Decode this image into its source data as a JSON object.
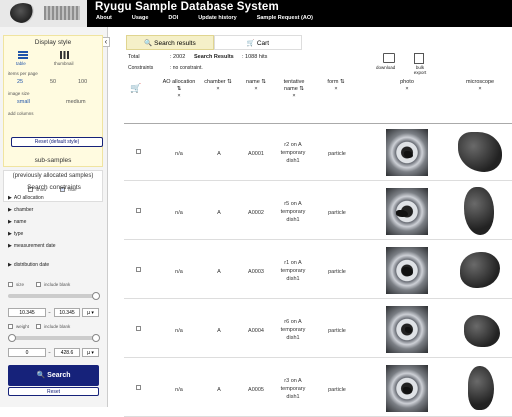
{
  "header": {
    "title": "Ryugu Sample Database System",
    "nav": [
      "About",
      "Usage",
      "DOI",
      "Update history",
      "Sample Request (AO)"
    ]
  },
  "sidebar": {
    "display_style_title": "Display style",
    "views": [
      "table",
      "thumbnail"
    ],
    "items_per_page_label": "items per page",
    "items_per_page": [
      "25",
      "50",
      "100"
    ],
    "image_size_label": "image size",
    "image_size": [
      "small",
      "medium"
    ],
    "add_columns": "add columns",
    "reset_default": "Reset (default style)",
    "subsamples_title": "sub-samples",
    "subsamples_subtitle": "(previously allocated samples)",
    "show": "show",
    "hide": "hide",
    "search_constraints_title": "Search constraints",
    "constraints": [
      "AO allocation",
      "chamber",
      "name",
      "type",
      "measurement date",
      "distribution date"
    ],
    "size_label": "size",
    "include_blank": "include blank",
    "size_from": "10.345",
    "size_to": "10.345",
    "weight_label": "weight",
    "weight_from": "0",
    "weight_to": "428.6",
    "search": "Search",
    "reset": "Reset"
  },
  "main": {
    "tabs": [
      "Search results",
      "Cart"
    ],
    "total_label": "Total",
    "total_value": ": 2002",
    "results_label": "Search Results",
    "results_value": ": 1088 hits",
    "constraints_label": "Constraints",
    "constraints_value": ": no constraint.",
    "download": "download",
    "bulk_export": "bulk export",
    "columns": [
      "AO allocation",
      "chamber",
      "name",
      "tentative name",
      "form",
      "photo",
      "microscope"
    ],
    "rows": [
      {
        "ao": "n/a",
        "chamber": "A",
        "name": "A0001",
        "tentative": "r2 on A temporary dish1",
        "form": "particle"
      },
      {
        "ao": "n/a",
        "chamber": "A",
        "name": "A0002",
        "tentative": "r5 on A temporary dish1",
        "form": "particle"
      },
      {
        "ao": "n/a",
        "chamber": "A",
        "name": "A0003",
        "tentative": "r1 on A temporary dish1",
        "form": "particle"
      },
      {
        "ao": "n/a",
        "chamber": "A",
        "name": "A0004",
        "tentative": "r6 on A temporary dish1",
        "form": "particle"
      },
      {
        "ao": "n/a",
        "chamber": "A",
        "name": "A0005",
        "tentative": "r3 on A temporary dish1",
        "form": "particle"
      }
    ]
  }
}
